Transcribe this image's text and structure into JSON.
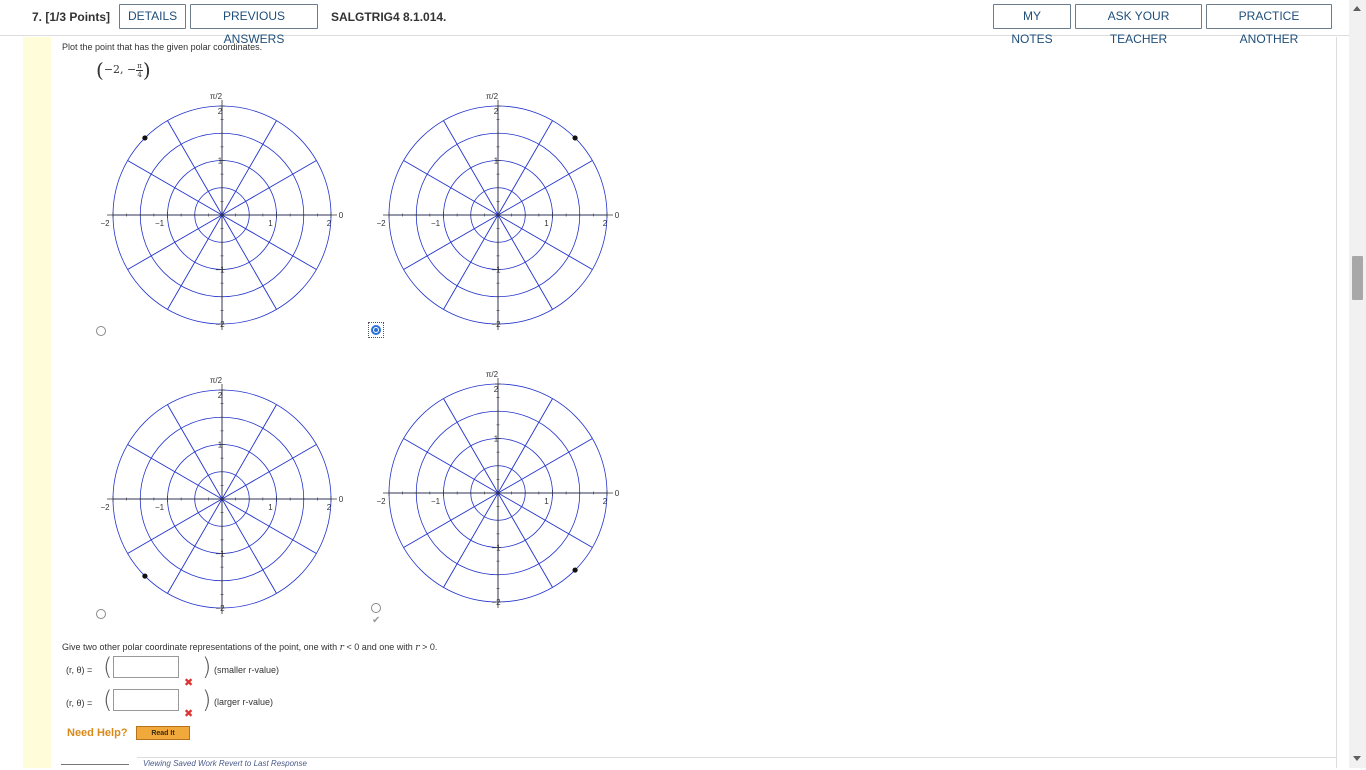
{
  "header": {
    "question_title": "7.  [1/3 Points]",
    "details_label": "DETAILS",
    "previous_answers_label": "PREVIOUS ANSWERS",
    "question_code": "SALGTRIG4 8.1.014.",
    "my_notes_label": "MY NOTES",
    "ask_teacher_label": "ASK YOUR TEACHER",
    "practice_another_label": "PRACTICE ANOTHER"
  },
  "question": {
    "prompt": "Plot the point that has the given polar coordinates.",
    "coord_r": "−2, −",
    "coord_num": "π",
    "coord_den": "4"
  },
  "plots": [
    {
      "top_label": "π/2",
      "zero_label": "0",
      "point_angle_deg": 135,
      "point_r": 2,
      "selected": false,
      "checked": false
    },
    {
      "top_label": "π/2",
      "zero_label": "0",
      "point_angle_deg": 45,
      "point_r": 2,
      "selected": true,
      "checked": false
    },
    {
      "top_label": "π/2",
      "zero_label": "0",
      "point_angle_deg": 225,
      "point_r": 2,
      "selected": false,
      "checked": false
    },
    {
      "top_label": "π/2",
      "zero_label": "0",
      "point_angle_deg": -45,
      "point_r": 2,
      "selected": false,
      "checked": true
    }
  ],
  "polar_axis_ticks": {
    "neg2": "−2",
    "neg1": "−1",
    "pos1": "1",
    "pos2": "2",
    "vpos2": "2",
    "vpos1": "1",
    "vneg1": "−1",
    "vneg2": "−2"
  },
  "colors": {
    "grid": "#2233cc",
    "accent": "#2a6fd6",
    "wrong": "#dd3333",
    "help": "#d98a1a"
  },
  "part2": {
    "instruction_pre": "Give two other polar coordinate representations of the point, one with ",
    "instruction_r1": "r",
    "instruction_mid": " < 0 and one with ",
    "instruction_r2": "r",
    "instruction_post": " > 0.",
    "row1_label": "(r, θ) =",
    "row1_value": "",
    "row1_hint": "(smaller r-value)",
    "row2_label": "(r, θ) =",
    "row2_value": "",
    "row2_hint": "(larger r-value)",
    "wrong_icon": "✖"
  },
  "help": {
    "need_help": "Need Help?",
    "read_it": "Read It"
  },
  "footer": {
    "saved_text": "Viewing Saved Work Revert to Last Response"
  }
}
